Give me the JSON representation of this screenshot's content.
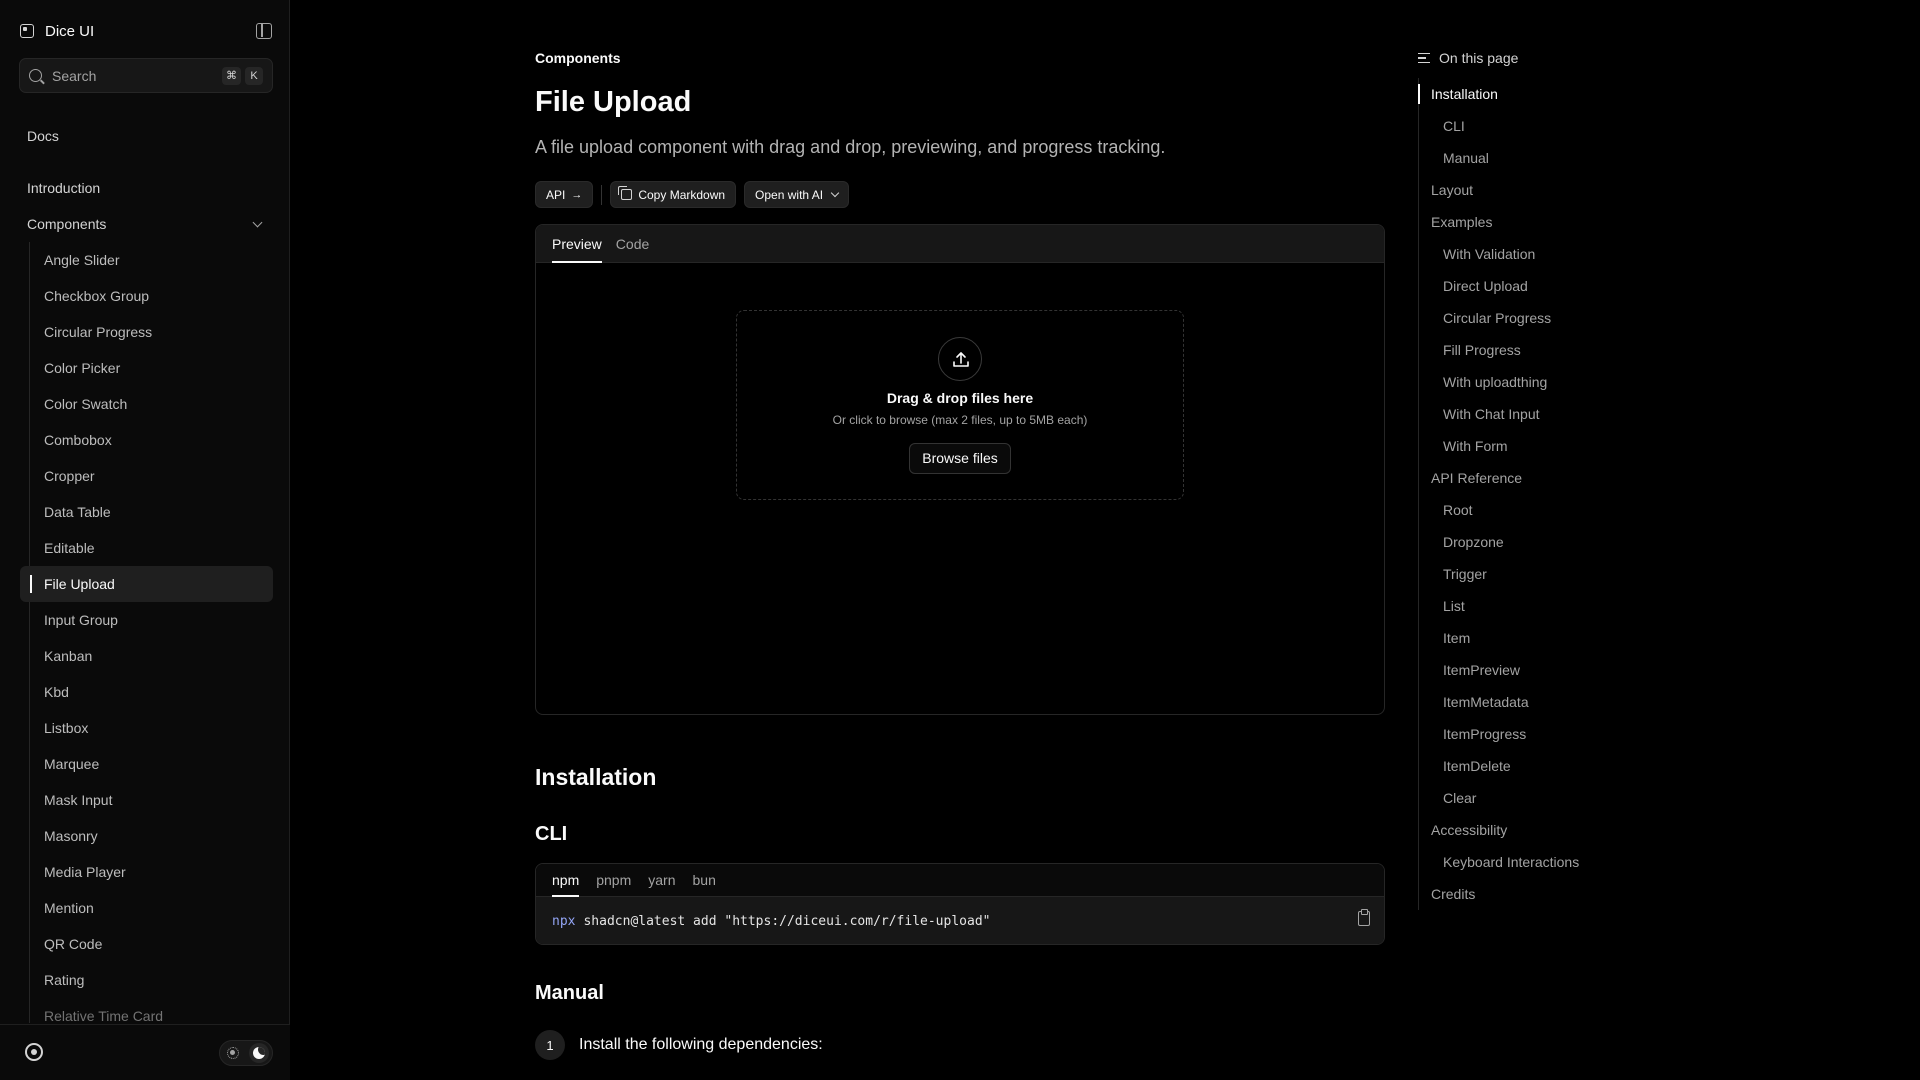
{
  "sidebar": {
    "title": "Dice UI",
    "search": {
      "placeholder": "Search",
      "kbd1": "⌘",
      "kbd2": "K"
    },
    "docs_label": "Docs",
    "intro_label": "Introduction",
    "components_label": "Components",
    "items": [
      {
        "label": "Angle Slider"
      },
      {
        "label": "Checkbox Group"
      },
      {
        "label": "Circular Progress"
      },
      {
        "label": "Color Picker"
      },
      {
        "label": "Color Swatch"
      },
      {
        "label": "Combobox"
      },
      {
        "label": "Cropper"
      },
      {
        "label": "Data Table"
      },
      {
        "label": "Editable"
      },
      {
        "label": "File Upload"
      },
      {
        "label": "Input Group"
      },
      {
        "label": "Kanban"
      },
      {
        "label": "Kbd"
      },
      {
        "label": "Listbox"
      },
      {
        "label": "Marquee"
      },
      {
        "label": "Mask Input"
      },
      {
        "label": "Masonry"
      },
      {
        "label": "Media Player"
      },
      {
        "label": "Mention"
      },
      {
        "label": "QR Code"
      },
      {
        "label": "Rating"
      },
      {
        "label": "Relative Time Card"
      }
    ],
    "active_item": "File Upload"
  },
  "main": {
    "breadcrumb": "Components",
    "title": "File Upload",
    "description": "A file upload component with drag and drop, previewing, and progress tracking.",
    "actions": {
      "api": "API",
      "copy": "Copy Markdown",
      "open_ai": "Open with AI"
    },
    "preview_tabs": {
      "preview": "Preview",
      "code": "Code"
    },
    "dropzone": {
      "title": "Drag & drop files here",
      "subtitle": "Or click to browse (max 2 files, up to 5MB each)",
      "button": "Browse files"
    },
    "installation_heading": "Installation",
    "cli_heading": "CLI",
    "pkg_tabs": {
      "npm": "npm",
      "pnpm": "pnpm",
      "yarn": "yarn",
      "bun": "bun"
    },
    "command": {
      "prefix": "npx",
      "rest": "shadcn@latest add \"https://diceui.com/r/file-upload\""
    },
    "manual_heading": "Manual",
    "step": {
      "number": "1",
      "text": "Install the following dependencies:"
    }
  },
  "toc": {
    "heading": "On this page",
    "items": [
      {
        "label": "Installation",
        "level": 1,
        "active": true
      },
      {
        "label": "CLI",
        "level": 2
      },
      {
        "label": "Manual",
        "level": 2
      },
      {
        "label": "Layout",
        "level": 1
      },
      {
        "label": "Examples",
        "level": 1
      },
      {
        "label": "With Validation",
        "level": 2
      },
      {
        "label": "Direct Upload",
        "level": 2
      },
      {
        "label": "Circular Progress",
        "level": 2
      },
      {
        "label": "Fill Progress",
        "level": 2
      },
      {
        "label": "With uploadthing",
        "level": 2
      },
      {
        "label": "With Chat Input",
        "level": 2
      },
      {
        "label": "With Form",
        "level": 2
      },
      {
        "label": "API Reference",
        "level": 1
      },
      {
        "label": "Root",
        "level": 2
      },
      {
        "label": "Dropzone",
        "level": 2
      },
      {
        "label": "Trigger",
        "level": 2
      },
      {
        "label": "List",
        "level": 2
      },
      {
        "label": "Item",
        "level": 2
      },
      {
        "label": "ItemPreview",
        "level": 2
      },
      {
        "label": "ItemMetadata",
        "level": 2
      },
      {
        "label": "ItemProgress",
        "level": 2
      },
      {
        "label": "ItemDelete",
        "level": 2
      },
      {
        "label": "Clear",
        "level": 2
      },
      {
        "label": "Accessibility",
        "level": 1
      },
      {
        "label": "Keyboard Interactions",
        "level": 2
      },
      {
        "label": "Credits",
        "level": 1
      }
    ]
  }
}
